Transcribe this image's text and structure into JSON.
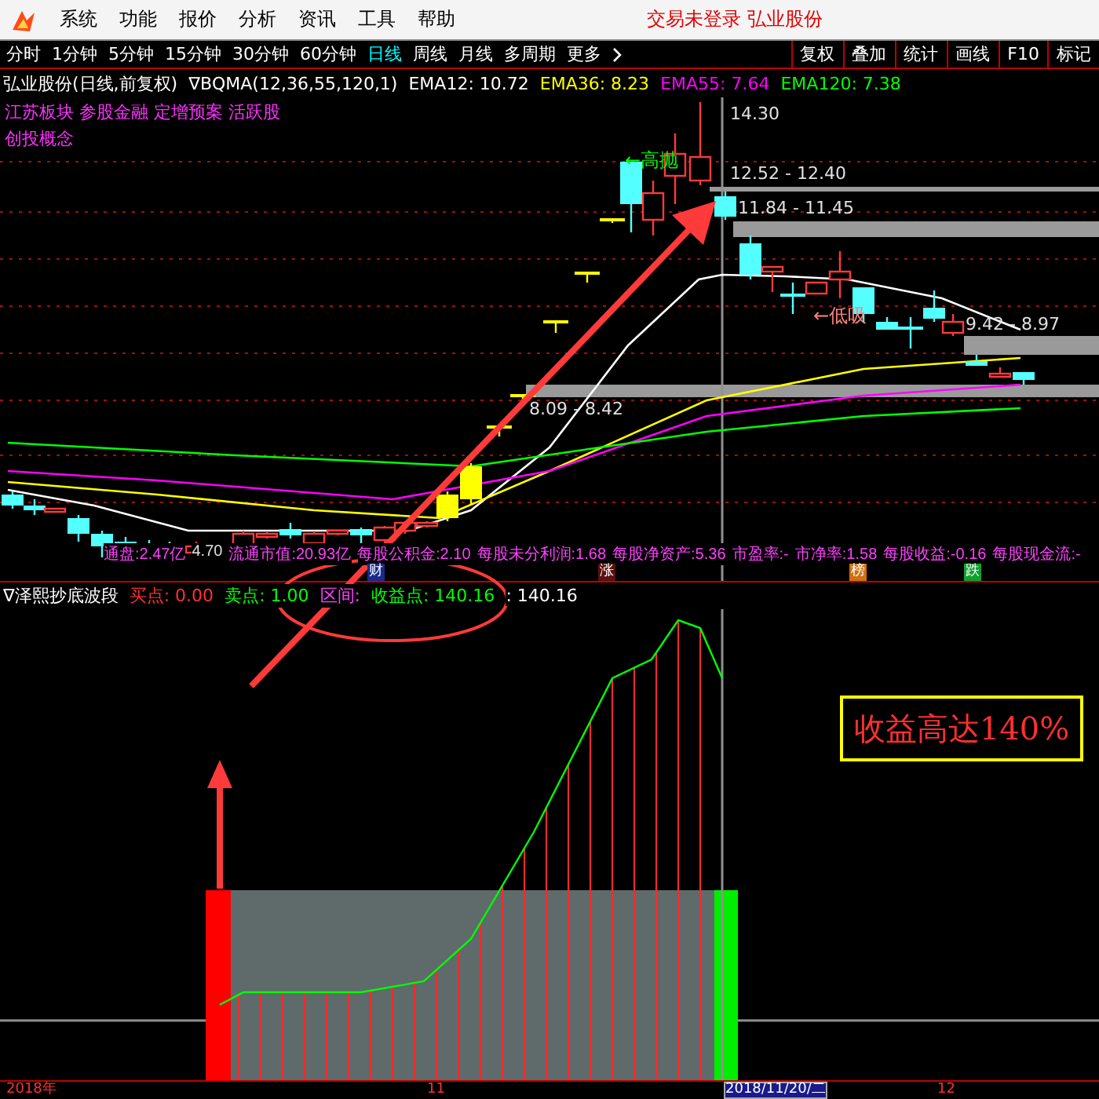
{
  "menu": {
    "items": [
      "系统",
      "功能",
      "报价",
      "分析",
      "资讯",
      "工具",
      "帮助"
    ],
    "status": "交易未登录 弘业股份"
  },
  "periods": [
    {
      "label": "分时",
      "selected": false
    },
    {
      "label": "1分钟",
      "selected": false
    },
    {
      "label": "5分钟",
      "selected": false
    },
    {
      "label": "15分钟",
      "selected": false
    },
    {
      "label": "30分钟",
      "selected": false
    },
    {
      "label": "60分钟",
      "selected": false
    },
    {
      "label": "日线",
      "selected": true
    },
    {
      "label": "周线",
      "selected": false
    },
    {
      "label": "月线",
      "selected": false
    },
    {
      "label": "多周期",
      "selected": false
    },
    {
      "label": "更多",
      "selected": false
    }
  ],
  "toolbar": [
    "复权",
    "叠加",
    "统计",
    "画线",
    "F10",
    "标记"
  ],
  "main_chart": {
    "title": "弘业股份(日线,前复权)",
    "indicator": "∇BQMA(12,36,55,120,1)",
    "legend": [
      {
        "label": "EMA12: 10.72",
        "color": "#ffffff"
      },
      {
        "label": "EMA36: 8.23",
        "color": "#ffff00"
      },
      {
        "label": "EMA55: 7.64",
        "color": "#ff00ff"
      },
      {
        "label": "EMA120: 7.38",
        "color": "#00ff00"
      }
    ],
    "tags": [
      "江苏板块 参股金融 定增预案 活跃股",
      "创投概念"
    ],
    "price_labels": [
      "14.30",
      "12.52 - 12.40",
      "11.84 - 11.45",
      "9.42 - 8.97",
      "8.09 - 8.42",
      "4.70"
    ],
    "signals": [
      {
        "label": "←高抛",
        "kind": "sell"
      },
      {
        "label": "←低吸",
        "kind": "buy"
      }
    ],
    "info": [
      "通盘:2.47亿",
      "流通市值:20.93亿",
      "每股公积金:2.10",
      "每股未分利润:1.68",
      "每股净资产:5.36",
      "市盈率:-",
      "市净率:1.58",
      "每股收益:-0.16",
      "每股现金流:-"
    ],
    "markers": [
      {
        "label": "财",
        "color": "#1a2a8a"
      },
      {
        "label": "涨",
        "color": "#5a1010"
      },
      {
        "label": "榜",
        "color": "#d07010"
      },
      {
        "label": "跌",
        "color": "#10a030"
      }
    ]
  },
  "indicator": {
    "name": "∇泽熙抄底波段",
    "values": [
      {
        "label": "买点: 0.00",
        "color": "#ff3030"
      },
      {
        "label": "卖点: 1.00",
        "color": "#00ff00"
      },
      {
        "label": "区间:",
        "color": "#ff40ff"
      },
      {
        "label": "收益点: 140.16",
        "color": "#00ff00"
      },
      {
        "label": ": 140.16",
        "color": "#ffffff"
      }
    ],
    "callout": "收益高达140%"
  },
  "x_axis": [
    "2018年",
    "11",
    "2018/11/20/二",
    "12"
  ]
}
